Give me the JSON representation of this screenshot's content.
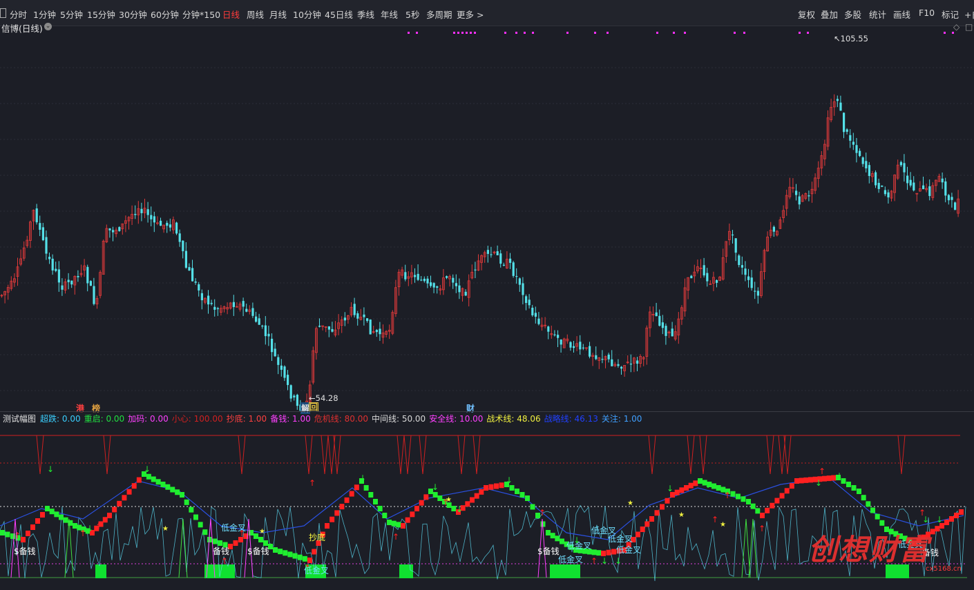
{
  "toolbar": {
    "items": [
      "分时",
      "1分钟",
      "5分钟",
      "15分钟",
      "30分钟",
      "60分钟",
      "分钟*150",
      "日线",
      "周线",
      "月线",
      "10分钟",
      "45日线",
      "季线",
      "年线",
      "5秒",
      "多周期",
      "更多 >"
    ],
    "active": "日线",
    "right_items": [
      "复权",
      "叠加",
      "多股",
      "统计",
      "画线",
      "F10",
      "标记",
      "+自"
    ]
  },
  "chart": {
    "title": "信博(日线)",
    "high_label": "105.55",
    "low_label": "54.28",
    "tags": [
      {
        "text": "港",
        "color": "#ff4040"
      },
      {
        "text": "榜",
        "color": "#e0a040"
      },
      {
        "text": "解",
        "color": "#e0e0e0"
      },
      {
        "text": "回",
        "color": "#e0c040"
      },
      {
        "text": "财",
        "color": "#70c0ff"
      }
    ],
    "colors": {
      "up": "#e03a3a",
      "down": "#54e0e8",
      "bg": "#1c1e26"
    }
  },
  "indicator": {
    "name": "测试幅图",
    "fields": [
      {
        "label": "超跌",
        "value": "0.00",
        "color": "#3ad0ff"
      },
      {
        "label": "重启",
        "value": "0.00",
        "color": "#20e040"
      },
      {
        "label": "加码",
        "value": "0.00",
        "color": "#ff40ff"
      },
      {
        "label": "小心",
        "value": "100.00",
        "color": "#d02020"
      },
      {
        "label": "抄底",
        "value": "1.00",
        "color": "#ff4040"
      },
      {
        "label": "备钱",
        "value": "1.00",
        "color": "#ff40ff"
      },
      {
        "label": "危机线",
        "value": "80.00",
        "color": "#e03030"
      },
      {
        "label": "中间线",
        "value": "50.00",
        "color": "#d8d8d8"
      },
      {
        "label": "安全线",
        "value": "10.00",
        "color": "#ff40ff"
      },
      {
        "label": "战术线",
        "value": "48.06",
        "color": "#f0f040"
      },
      {
        "label": "战略线",
        "value": "46.13",
        "color": "#2040ff"
      },
      {
        "label": "关注",
        "value": "1.00",
        "color": "#40a0ff"
      }
    ],
    "annotations": [
      {
        "text": "$备钱",
        "color": "#ffffff"
      },
      {
        "text": "备钱",
        "color": "#ffffff"
      },
      {
        "text": "$备钱",
        "color": "#ffffff"
      },
      {
        "text": "低金叉",
        "color": "#70e0ff"
      },
      {
        "text": "抄底",
        "color": "#ffff40"
      },
      {
        "text": "低金叉",
        "color": "#70e0ff"
      },
      {
        "text": "$备钱",
        "color": "#ffffff"
      },
      {
        "text": "低金叉",
        "color": "#70e0ff"
      },
      {
        "text": "低金叉",
        "color": "#70e0ff"
      },
      {
        "text": "低金叉",
        "color": "#70e0ff"
      },
      {
        "text": "低金叉",
        "color": "#70e0ff"
      },
      {
        "text": "低金叉",
        "color": "#70e0ff"
      },
      {
        "text": "低金叉",
        "color": "#70e0ff"
      },
      {
        "text": "备钱",
        "color": "#ffffff"
      }
    ]
  },
  "watermark": {
    "text": "创想财富",
    "url": "cx5168.cn"
  }
}
